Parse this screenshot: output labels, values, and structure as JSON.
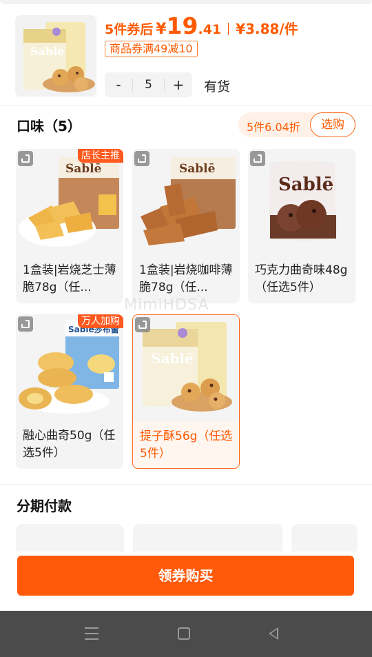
{
  "product": {
    "price_prefix": "5件券后",
    "currency": "¥",
    "price_int": "19",
    "price_dec": ".41",
    "unit_price": "¥3.88/件",
    "coupon": "商品券满49减10",
    "quantity": "5",
    "decrement": "-",
    "increment": "+",
    "stock": "有货"
  },
  "flavors": {
    "title": "口味（5）",
    "promo": "5件6.04折",
    "promo_button": "选购",
    "options": [
      {
        "label": "1盒装|岩烧芝士薄脆78g（任...",
        "badge": "店长主推",
        "brand": "Sablē",
        "selected": false
      },
      {
        "label": "1盒装|岩烧咖啡薄脆78g（任...",
        "badge": "",
        "brand": "Sablē",
        "selected": false
      },
      {
        "label": "巧克力曲奇味48g（任选5件）",
        "badge": "",
        "brand": "Sablē",
        "selected": false
      },
      {
        "label": "融心曲奇50g（任选5件）",
        "badge": "万人加购",
        "brand": "Sablē莎布蕾",
        "selected": false
      },
      {
        "label": "提子酥56g（任选5件）",
        "badge": "",
        "brand": "Sablē",
        "selected": true
      }
    ]
  },
  "installment": {
    "title": "分期付款"
  },
  "buy": {
    "label": "领券购买"
  },
  "watermark": "MimiHDSA",
  "colors": {
    "accent": "#ff5a0a",
    "nav_bar": "#4b4b4b"
  },
  "icons": {
    "zoom": "expand-icon",
    "menu": "menu-icon",
    "home": "home-icon",
    "back": "back-icon"
  }
}
